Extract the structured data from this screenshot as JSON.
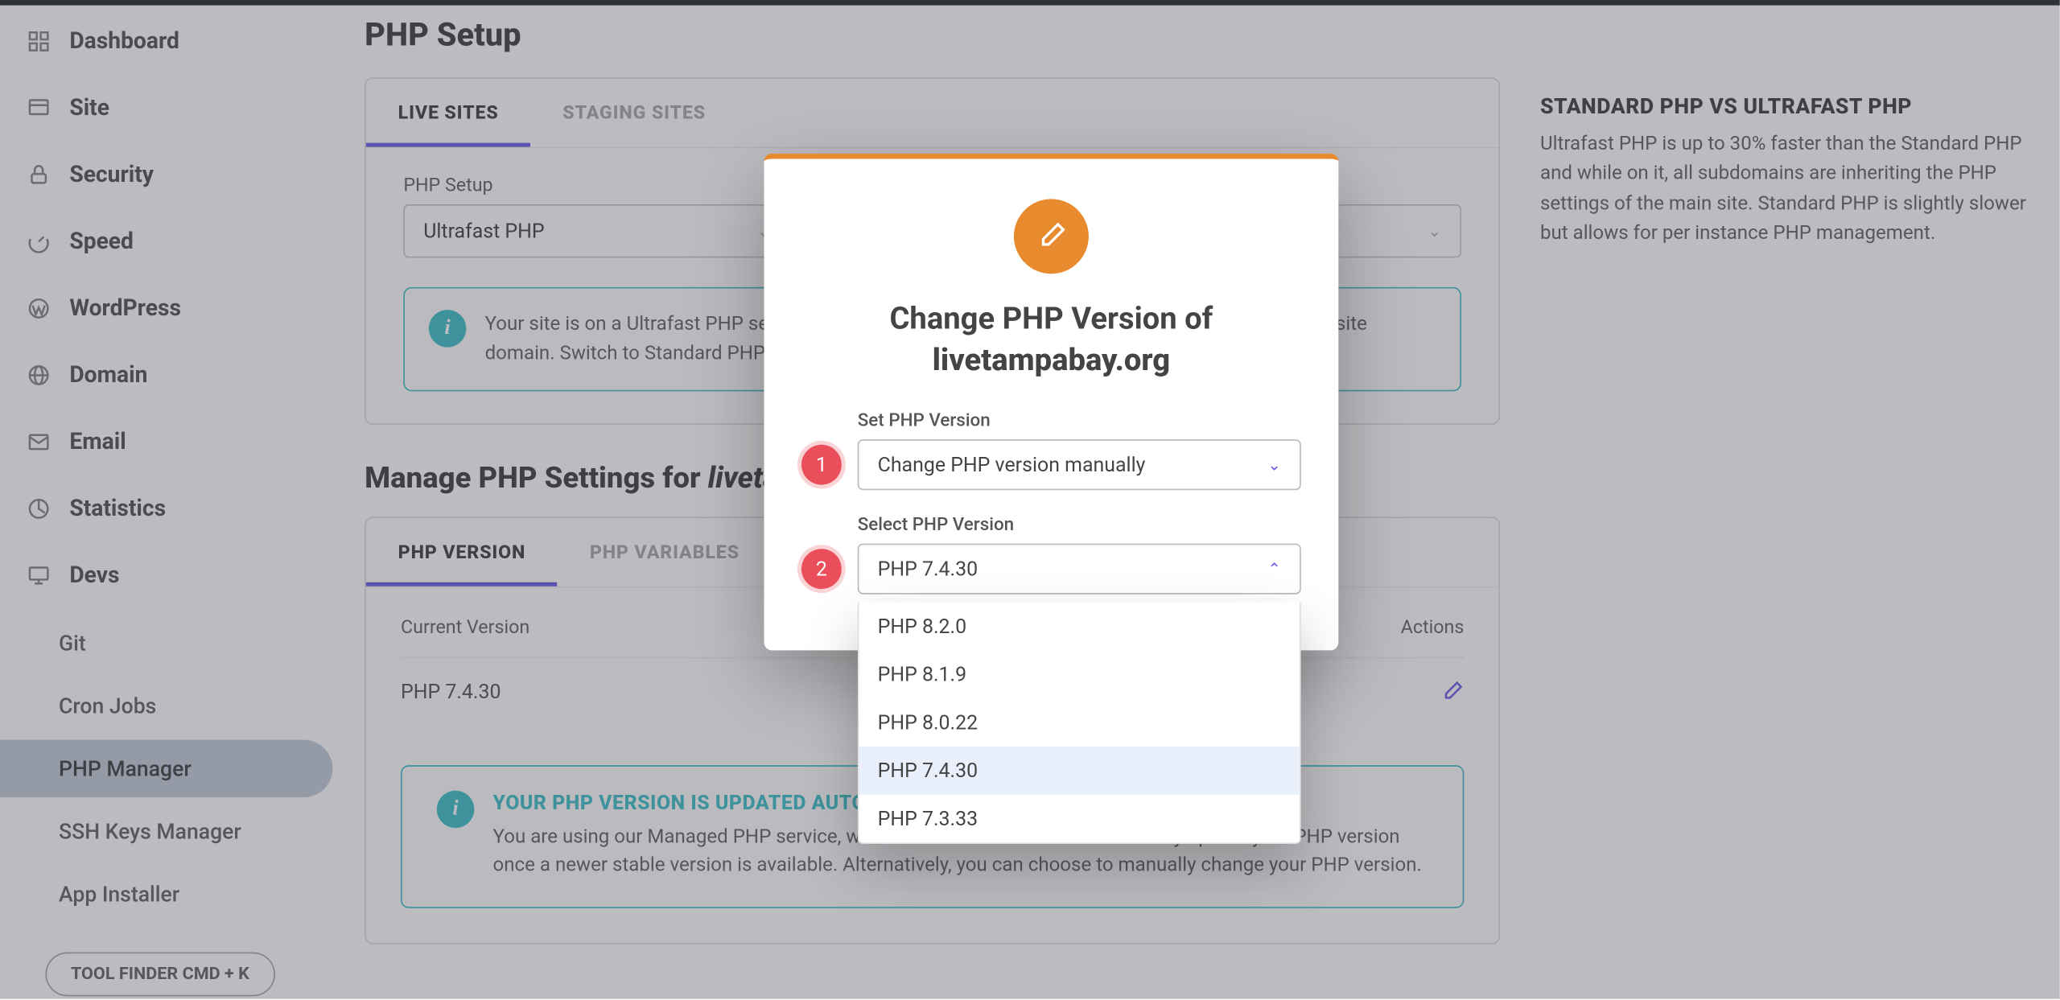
{
  "sidebar": {
    "items": [
      {
        "label": "Dashboard"
      },
      {
        "label": "Site"
      },
      {
        "label": "Security"
      },
      {
        "label": "Speed"
      },
      {
        "label": "WordPress"
      },
      {
        "label": "Domain"
      },
      {
        "label": "Email"
      },
      {
        "label": "Statistics"
      },
      {
        "label": "Devs"
      }
    ],
    "subitems": [
      {
        "label": "Git"
      },
      {
        "label": "Cron Jobs"
      },
      {
        "label": "PHP Manager",
        "active": true
      },
      {
        "label": "SSH Keys Manager"
      },
      {
        "label": "App Installer"
      }
    ],
    "tool_finder": "TOOL FINDER CMD + K"
  },
  "page": {
    "title": "PHP Setup",
    "tabs": {
      "live": "LIVE SITES",
      "staging": "STAGING SITES"
    },
    "php_setup_label": "PHP Setup",
    "php_setup_value": "Ultrafast PHP",
    "info_box_text": "Your site is on a Ultrafast PHP setup. All subdomains are inheriting the PHP settings of the primary site domain. Switch to Standard PHP if you need per instance PHP management.",
    "manage_title_prefix": "Manage PHP Settings for ",
    "manage_title_domain": "livetampabay.org",
    "settings_tabs": {
      "version": "PHP VERSION",
      "variables": "PHP VARIABLES"
    },
    "table": {
      "col1": "Current Version",
      "col2": "Actions",
      "value": "PHP 7.4.30"
    },
    "auto_box": {
      "title": "YOUR PHP VERSION IS UPDATED AUTOMATICALLY",
      "text": "You are using our Managed PHP service, which means that we will automatically update your PHP version once a newer stable version is available. Alternatively, you can choose to manually change your PHP version."
    }
  },
  "rightcol": {
    "title": "STANDARD PHP VS ULTRAFAST PHP",
    "text": "Ultrafast PHP is up to 30% faster than the Standard PHP and while on it, all subdomains are inheriting the PHP settings of the main site. Standard PHP is slightly slower but allows for per instance PHP management."
  },
  "modal": {
    "title_prefix": "Change PHP Version of",
    "title_domain": "livetampabay.org",
    "field1": {
      "label": "Set PHP Version",
      "value": "Change PHP version manually",
      "badge": "1"
    },
    "field2": {
      "label": "Select PHP Version",
      "value": "PHP 7.4.30",
      "badge": "2",
      "options": [
        "PHP 8.2.0",
        "PHP 8.1.9",
        "PHP 8.0.22",
        "PHP 7.4.30",
        "PHP 7.3.33"
      ],
      "selected": "PHP 7.4.30"
    }
  }
}
